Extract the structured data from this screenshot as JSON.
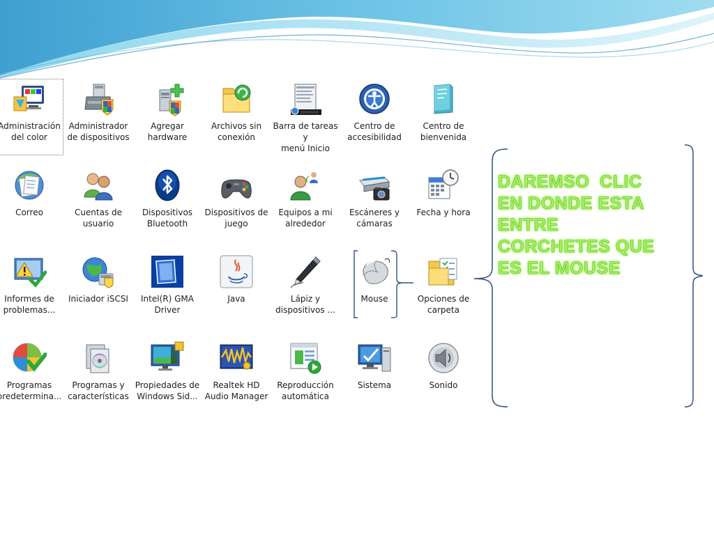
{
  "control_panel": {
    "items": [
      {
        "label": "Administración\ndel color",
        "icon": "color-management-icon"
      },
      {
        "label": "Administrador\nde dispositivos",
        "icon": "device-manager-icon"
      },
      {
        "label": "Agregar\nhardware",
        "icon": "add-hardware-icon"
      },
      {
        "label": "Archivos sin\nconexión",
        "icon": "offline-files-icon"
      },
      {
        "label": "Barra de tareas y\nmenú Inicio",
        "icon": "taskbar-start-menu-icon"
      },
      {
        "label": "Centro de\naccesibilidad",
        "icon": "ease-of-access-icon"
      },
      {
        "label": "Centro de\nbienvenida",
        "icon": "welcome-center-icon"
      },
      {
        "label": "Correo",
        "icon": "mail-icon"
      },
      {
        "label": "Cuentas de\nusuario",
        "icon": "user-accounts-icon"
      },
      {
        "label": "Dispositivos\nBluetooth",
        "icon": "bluetooth-icon"
      },
      {
        "label": "Dispositivos de\njuego",
        "icon": "game-controller-icon"
      },
      {
        "label": "Equipos a mi\nalrededor",
        "icon": "people-near-me-icon"
      },
      {
        "label": "Escáneres y\ncámaras",
        "icon": "scanner-camera-icon"
      },
      {
        "label": "Fecha y hora",
        "icon": "date-time-icon"
      },
      {
        "label": "Informes de\nproblemas...",
        "icon": "problem-reports-icon"
      },
      {
        "label": "Iniciador iSCSI",
        "icon": "iscsi-initiator-icon"
      },
      {
        "label": "Intel(R) GMA\nDriver",
        "icon": "intel-gma-icon"
      },
      {
        "label": "Java",
        "icon": "java-icon"
      },
      {
        "label": "Lápiz y\ndispositivos ...",
        "icon": "pen-input-icon"
      },
      {
        "label": "Mouse",
        "icon": "mouse-icon"
      },
      {
        "label": "Opciones de\ncarpeta",
        "icon": "folder-options-icon"
      },
      {
        "label": "Programas\npredetermina...",
        "icon": "default-programs-icon"
      },
      {
        "label": "Programas y\ncaracterísticas",
        "icon": "programs-features-icon"
      },
      {
        "label": "Propiedades de\nWindows Sid...",
        "icon": "sidebar-properties-icon"
      },
      {
        "label": "Realtek HD\nAudio Manager",
        "icon": "realtek-audio-icon"
      },
      {
        "label": "Reproducción\nautomática",
        "icon": "autoplay-icon"
      },
      {
        "label": "Sistema",
        "icon": "system-icon"
      },
      {
        "label": "Sonido",
        "icon": "sound-icon"
      }
    ]
  },
  "instruction": {
    "lines": [
      "DAREMSO  CLIC",
      "EN DONDE ESTA",
      "ENTRE",
      "CORCHETES QUE",
      "ES EL MOUSE"
    ]
  },
  "colors": {
    "instruction_text": "#a8f064",
    "bracket": "#2f4f7f",
    "wave_primary": "#4aa9d1"
  }
}
